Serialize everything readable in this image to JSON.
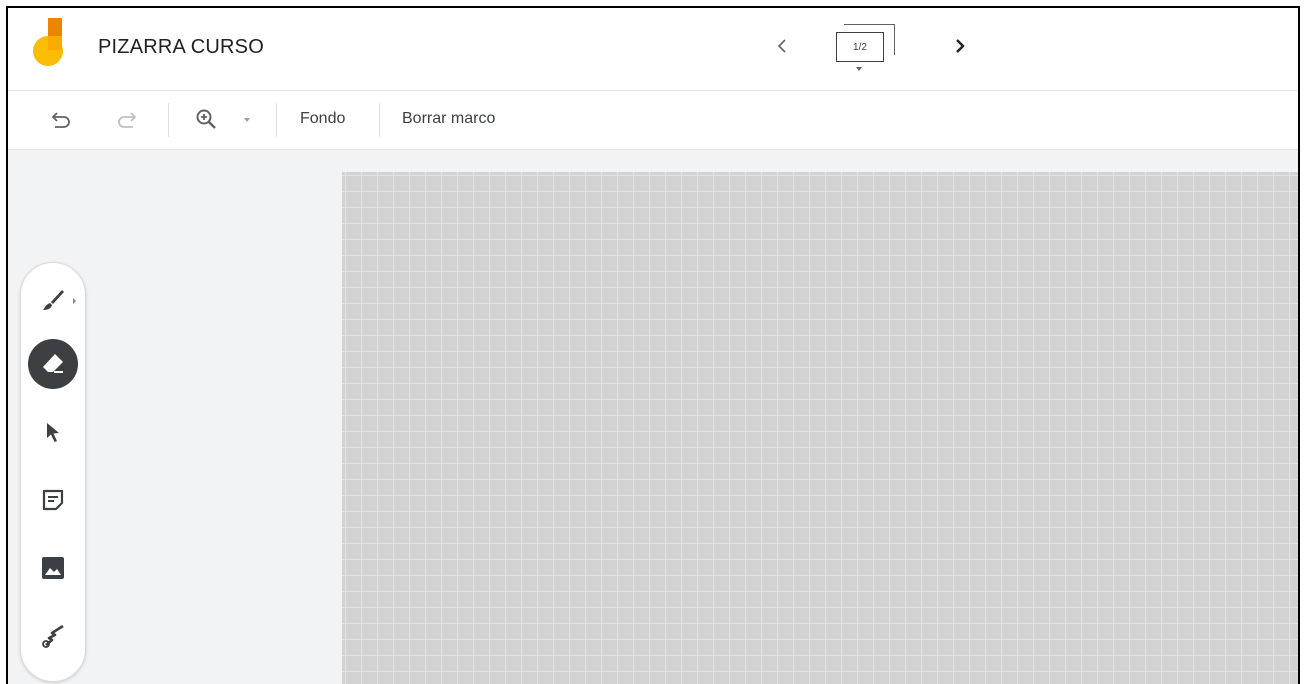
{
  "app": {
    "title": "PIZARRA CURSO",
    "brand_colors": {
      "orange": "#f29900",
      "dark_orange": "#ea8600",
      "yellow": "#fbbc04"
    }
  },
  "frame_nav": {
    "prev_icon": "chevron-left-icon",
    "next_icon": "chevron-right-icon",
    "indicator": "1/2"
  },
  "toolbar": {
    "undo_icon": "undo-icon",
    "redo_icon": "redo-icon",
    "zoom_icon": "zoom-in-icon",
    "zoom_dropdown_icon": "dropdown-arrow-icon",
    "background_label": "Fondo",
    "clear_frame_label": "Borrar marco"
  },
  "tools": [
    {
      "name": "pen",
      "icon": "brush-icon",
      "active": false
    },
    {
      "name": "eraser",
      "icon": "eraser-icon",
      "active": true
    },
    {
      "name": "select",
      "icon": "cursor-arrow-icon",
      "active": false
    },
    {
      "name": "sticky-note",
      "icon": "sticky-note-icon",
      "active": false
    },
    {
      "name": "image",
      "icon": "image-icon",
      "active": false
    },
    {
      "name": "laser",
      "icon": "laser-pointer-icon",
      "active": false
    }
  ],
  "board": {
    "background": "grid",
    "color": "#d3d3d3",
    "grid_color": "#e2e2e2"
  }
}
